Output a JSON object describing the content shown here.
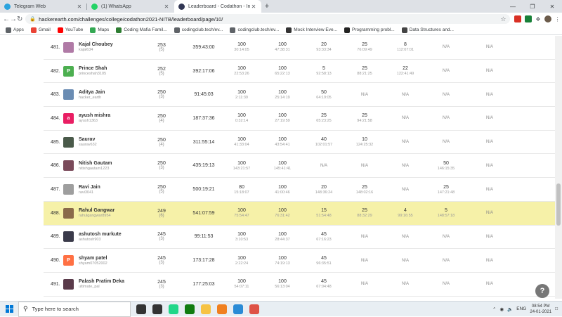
{
  "browser": {
    "tabs": [
      {
        "label": "Telegram Web",
        "icon": "telegram-icon",
        "color": "#2aa3de",
        "active": false
      },
      {
        "label": "(1) WhatsApp",
        "icon": "whatsapp-icon",
        "color": "#25d366",
        "active": false
      },
      {
        "label": "Leaderboard - Codathon - Inter",
        "icon": "hackerearth-icon",
        "color": "#323754",
        "active": true
      }
    ],
    "new_tab": "+",
    "url": "hackerearth.com/challenges/college/codathon2021-NITB/leaderboard/page/10/",
    "bookmarks": [
      {
        "label": "Apps",
        "icon": "apps-grid-icon",
        "color": "#5f6368"
      },
      {
        "label": "Gmail",
        "icon": "gmail-icon",
        "color": "#ea4335"
      },
      {
        "label": "YouTube",
        "icon": "youtube-icon",
        "color": "#ff0000"
      },
      {
        "label": "Maps",
        "icon": "maps-icon",
        "color": "#34a853"
      },
      {
        "label": "Coding Mafia Famil...",
        "icon": "coding-mafia-icon",
        "color": "#2e7d32"
      },
      {
        "label": "codingclub.tech/ev...",
        "icon": "globe-icon",
        "color": "#5f6368"
      },
      {
        "label": "codingclub.tech/ev...",
        "icon": "globe-icon",
        "color": "#5f6368"
      },
      {
        "label": "Mock Interview Eve...",
        "icon": "mock-interview-icon",
        "color": "#333333"
      },
      {
        "label": "Programming probl...",
        "icon": "programming-icon",
        "color": "#222222"
      },
      {
        "label": "Data Structures and...",
        "icon": "data-structures-icon",
        "color": "#444444"
      }
    ]
  },
  "leaderboard": {
    "rows": [
      {
        "rank": "481.",
        "name": "Kajal Choubey",
        "handle": "kajal634",
        "avatar": "photo",
        "avatar_color": "#b07aa6",
        "score": "253",
        "solved": "(5)",
        "time": "359:43:00",
        "problems": [
          {
            "s": "100",
            "t": "30:14:05"
          },
          {
            "s": "100",
            "t": "47:38:31"
          },
          {
            "s": "20",
            "t": "93:33:34"
          },
          {
            "s": "25",
            "t": "76:09:49"
          },
          {
            "s": "8",
            "t": "112:07:01"
          },
          {
            "na": "N/A"
          },
          {
            "na": "N/A"
          }
        ]
      },
      {
        "rank": "482.",
        "name": "Prince Shah",
        "handle": "princeshah3105",
        "avatar": "P",
        "avatar_color": "#4caf50",
        "score": "252",
        "solved": "(5)",
        "time": "392:17:06",
        "problems": [
          {
            "s": "100",
            "t": "22:53:26"
          },
          {
            "s": "100",
            "t": "65:22:13"
          },
          {
            "s": "5",
            "t": "92:58:13"
          },
          {
            "s": "25",
            "t": "88:21:25"
          },
          {
            "s": "22",
            "t": "122:41:49"
          },
          {
            "na": "N/A"
          },
          {
            "na": "N/A"
          }
        ]
      },
      {
        "rank": "483.",
        "name": "Aditya Jain",
        "handle": "hacker_earth",
        "avatar": "photo",
        "avatar_color": "#6a8cb3",
        "score": "250",
        "solved": "(3)",
        "time": "91:45:03",
        "problems": [
          {
            "s": "100",
            "t": "2:11:39"
          },
          {
            "s": "100",
            "t": "25:14:19"
          },
          {
            "s": "50",
            "t": "64:19:05"
          },
          {
            "na": "N/A"
          },
          {
            "na": "N/A"
          },
          {
            "na": "N/A"
          },
          {
            "na": "N/A"
          }
        ]
      },
      {
        "rank": "484.",
        "name": "ayush mishra",
        "handle": "ayush1363",
        "avatar": "a",
        "avatar_color": "#e91e63",
        "score": "250",
        "solved": "(4)",
        "time": "187:37:36",
        "problems": [
          {
            "s": "100",
            "t": "0:32:14"
          },
          {
            "s": "100",
            "t": "27:19:59"
          },
          {
            "s": "25",
            "t": "65:23:25"
          },
          {
            "s": "25",
            "t": "94:21:58"
          },
          {
            "na": "N/A"
          },
          {
            "na": "N/A"
          },
          {
            "na": "N/A"
          }
        ]
      },
      {
        "rank": "485.",
        "name": "Saurav",
        "handle": "saurav632",
        "avatar": "photo",
        "avatar_color": "#4a5a4a",
        "score": "250",
        "solved": "(4)",
        "time": "311:55:14",
        "problems": [
          {
            "s": "100",
            "t": "41:33:04"
          },
          {
            "s": "100",
            "t": "43:54:41"
          },
          {
            "s": "40",
            "t": "102:01:57"
          },
          {
            "s": "10",
            "t": "124:25:32"
          },
          {
            "na": "N/A"
          },
          {
            "na": "N/A"
          },
          {
            "na": "N/A"
          }
        ]
      },
      {
        "rank": "486.",
        "name": "Nitish Gautam",
        "handle": "nitishgautam1223",
        "avatar": "photo",
        "avatar_color": "#7a4a5a",
        "score": "250",
        "solved": "(3)",
        "time": "435:19:13",
        "problems": [
          {
            "s": "100",
            "t": "143:21:57"
          },
          {
            "s": "100",
            "t": "145:41:41"
          },
          {
            "na": "N/A"
          },
          {
            "na": "N/A"
          },
          {
            "na": "N/A"
          },
          {
            "s": "50",
            "t": "146:15:35"
          },
          {
            "na": "N/A"
          }
        ]
      },
      {
        "rank": "487.",
        "name": "Ravi Jain",
        "handle": "ravi3041",
        "avatar": "photo",
        "avatar_color": "#9e9e9e",
        "score": "250",
        "solved": "(5)",
        "time": "500:19:21",
        "problems": [
          {
            "s": "80",
            "t": "15:18:07"
          },
          {
            "s": "100",
            "t": "41:00:46"
          },
          {
            "s": "20",
            "t": "148:36:24"
          },
          {
            "s": "25",
            "t": "148:02:16"
          },
          {
            "na": "N/A"
          },
          {
            "s": "25",
            "t": "147:21:48"
          },
          {
            "na": "N/A"
          }
        ]
      },
      {
        "rank": "488.",
        "name": "Rahul Gangwar",
        "handle": "rahulgangwar8954",
        "avatar": "photo",
        "avatar_color": "#8a6a4a",
        "score": "249",
        "solved": "(6)",
        "time": "541:07:59",
        "highlight": true,
        "problems": [
          {
            "s": "100",
            "t": "75:54:47"
          },
          {
            "s": "100",
            "t": "76:31:42"
          },
          {
            "s": "15",
            "t": "51:54:48"
          },
          {
            "s": "25",
            "t": "88:32:29"
          },
          {
            "s": "4",
            "t": "99:16:55"
          },
          {
            "s": "5",
            "t": "148:57:18"
          },
          {
            "na": "N/A"
          }
        ]
      },
      {
        "rank": "489.",
        "name": "ashutosh murkute",
        "handle": "ashutosh903",
        "avatar": "photo",
        "avatar_color": "#3a3a4a",
        "score": "245",
        "solved": "(3)",
        "time": "99:11:53",
        "problems": [
          {
            "s": "100",
            "t": "3:10:53"
          },
          {
            "s": "100",
            "t": "28:44:37"
          },
          {
            "s": "45",
            "t": "67:16:23"
          },
          {
            "na": "N/A"
          },
          {
            "na": "N/A"
          },
          {
            "na": "N/A"
          },
          {
            "na": "N/A"
          }
        ]
      },
      {
        "rank": "490.",
        "name": "shyam patel",
        "handle": "shyam07052002",
        "avatar": "P",
        "avatar_color": "#ff7043",
        "score": "245",
        "solved": "(3)",
        "time": "173:17:28",
        "problems": [
          {
            "s": "100",
            "t": "2:22:24"
          },
          {
            "s": "100",
            "t": "74:19:13"
          },
          {
            "s": "45",
            "t": "96:35:51"
          },
          {
            "na": "N/A"
          },
          {
            "na": "N/A"
          },
          {
            "na": "N/A"
          },
          {
            "na": "N/A"
          }
        ]
      },
      {
        "rank": "491.",
        "name": "Palash Pratim Deka",
        "handle": "ultimate_pal",
        "avatar": "photo",
        "avatar_color": "#5a3a4a",
        "score": "245",
        "solved": "(3)",
        "time": "177:25:03",
        "problems": [
          {
            "s": "100",
            "t": "54:07:11"
          },
          {
            "s": "100",
            "t": "56:13:04"
          },
          {
            "s": "45",
            "t": "67:04:48"
          },
          {
            "na": "N/A"
          },
          {
            "na": "N/A"
          },
          {
            "na": "N/A"
          },
          {
            "na": "N/A"
          }
        ]
      }
    ]
  },
  "help_button": "?",
  "taskbar": {
    "search_placeholder": "Type here to search",
    "apps": [
      {
        "icon": "task-view-icon",
        "color": "#333333"
      },
      {
        "icon": "widgets-icon",
        "color": "#333333"
      },
      {
        "icon": "pycharm-icon",
        "color": "#21d789"
      },
      {
        "icon": "xbox-icon",
        "color": "#107c10"
      },
      {
        "icon": "file-explorer-icon",
        "color": "#f6c344"
      },
      {
        "icon": "vlc-icon",
        "color": "#f08020"
      },
      {
        "icon": "edge-icon",
        "color": "#2a8bd6"
      },
      {
        "icon": "chrome-icon",
        "color": "#de5246"
      }
    ],
    "language": "ENG",
    "time": "08:54 PM",
    "date": "24-01-2021"
  }
}
